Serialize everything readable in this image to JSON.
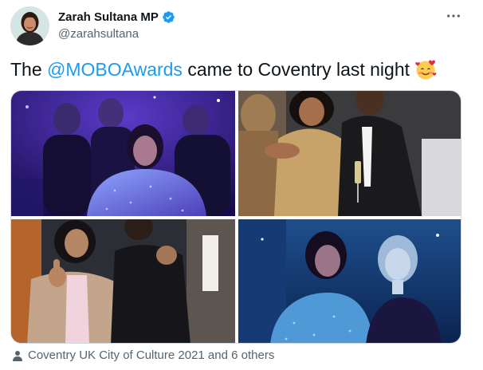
{
  "author": {
    "display_name": "Zarah Sultana MP",
    "handle": "@zarahsultana",
    "verified_icon": "verified-badge-icon",
    "avatar_icon": "profile-avatar"
  },
  "menu_icon": "more-options-icon",
  "tweet": {
    "text_before": "The ",
    "mention": "@MOBOAwards",
    "text_after": " came to Coventry last night",
    "emoji_icon": "smiling-face-with-hearts-emoji"
  },
  "media": [
    {
      "name": "photo-selfie-group"
    },
    {
      "name": "photo-two-people-drinks"
    },
    {
      "name": "photo-thumbs-up"
    },
    {
      "name": "photo-selfie-two-women"
    }
  ],
  "tagged": {
    "icon": "person-icon",
    "label": "Coventry UK City of Culture 2021 and 6 others"
  },
  "colors": {
    "link": "#1d9bf0",
    "secondary_text": "#536471",
    "primary_text": "#0f1419",
    "border": "#cfd9de"
  }
}
